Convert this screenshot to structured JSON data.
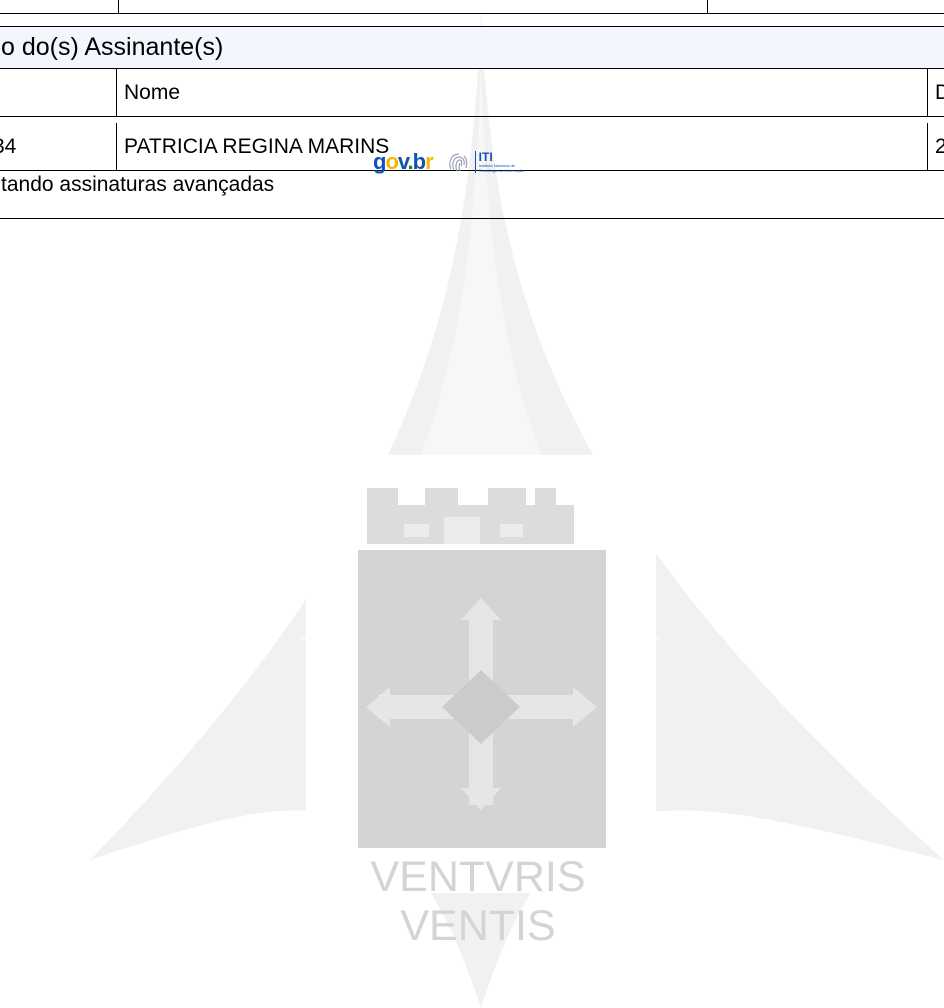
{
  "watermark": {
    "motto": "VENTVRIS VENTIS",
    "color": "#d9d9d9"
  },
  "signers_table": {
    "title": "o do(s) Assinante(s)",
    "header_color": "#f4f6fd",
    "columns": [
      "",
      "Nome",
      "D"
    ],
    "rows": [
      [
        "34",
        "PATRICIA REGINA MARINS",
        "2"
      ]
    ],
    "footer": "tando assinaturas avançadas"
  },
  "logos": {
    "govbr": {
      "g": "g",
      "o": "o",
      "v": "v",
      "dot": ".",
      "b": "b",
      "r": "r"
    },
    "iti": {
      "title": "ITI",
      "subtitle_line1": "Instituto Nacional de",
      "subtitle_line2": "Tecnologia da Informação"
    },
    "colors": {
      "blue": "#1351b4",
      "yellow": "#f5b800",
      "green": "#168821"
    }
  }
}
